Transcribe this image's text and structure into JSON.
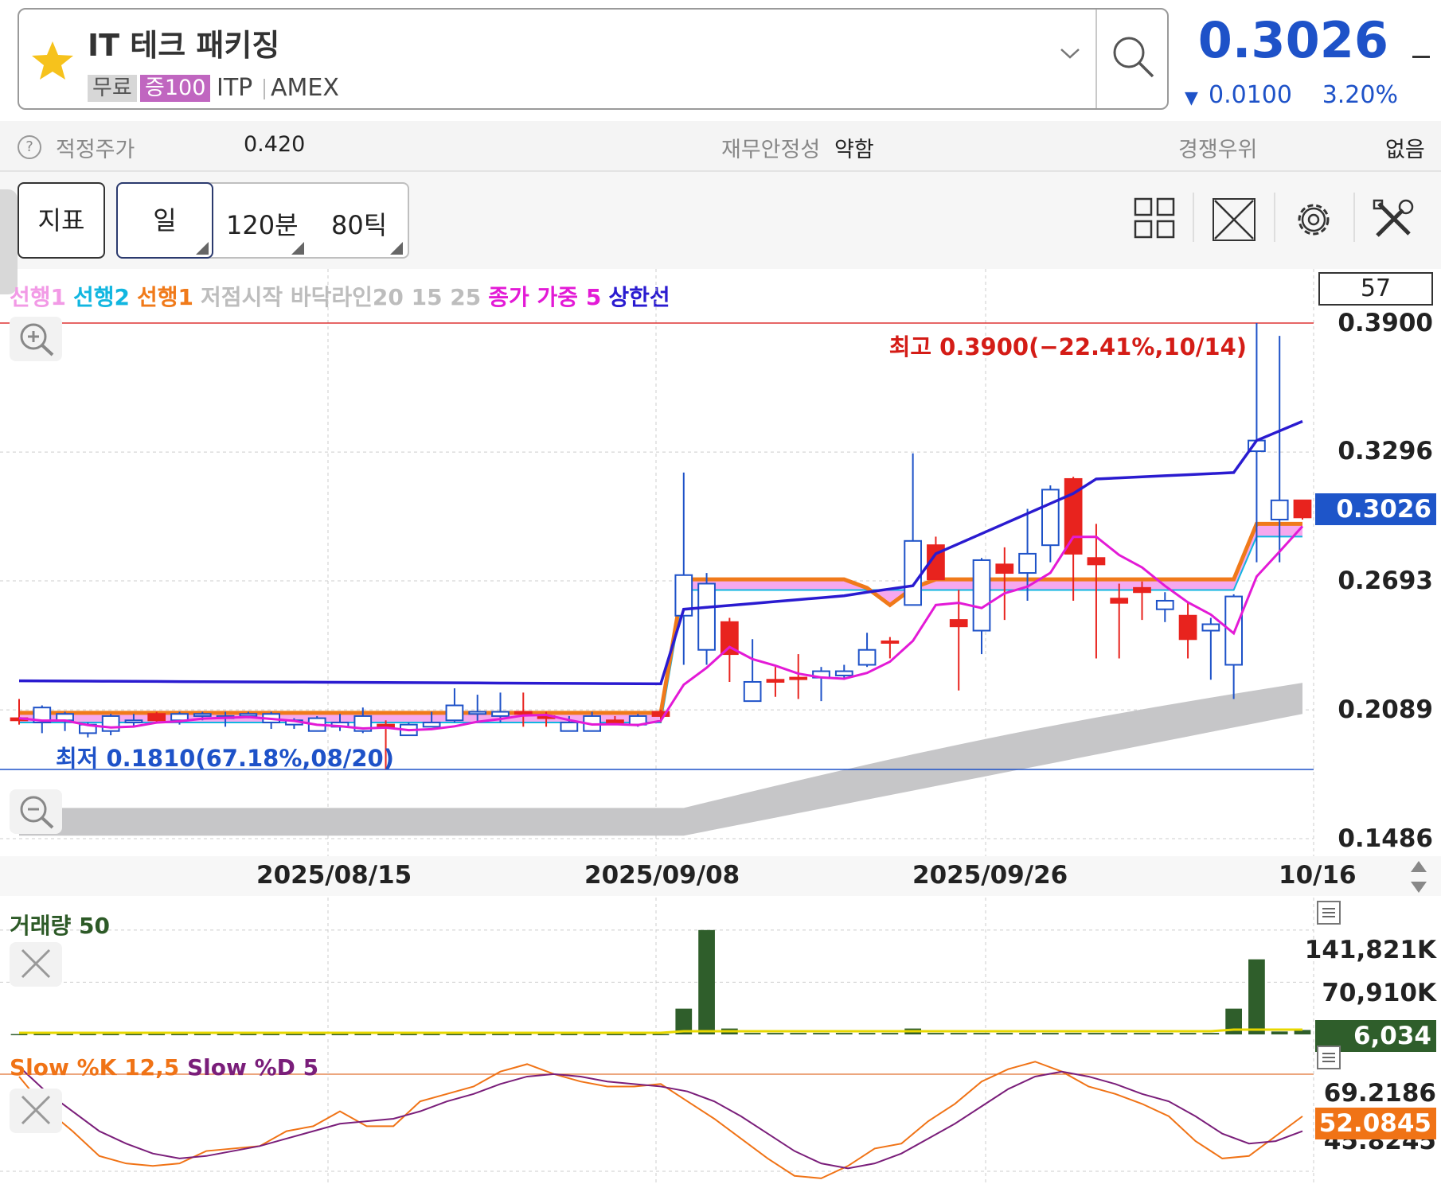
{
  "header": {
    "stock_name": "IT 테크 패키징",
    "badge_free": "무료",
    "badge_margin": "증100",
    "ticker": "ITP",
    "exchange": "AMEX",
    "price": "0.3026",
    "change": "0.0100",
    "change_pct": "3.20%",
    "change_direction": "down",
    "price_color": "#1e52c8"
  },
  "info_bar": {
    "fair_price_label": "적정주가",
    "fair_price_value": "0.420",
    "stability_label": "재무안정성",
    "stability_value": "약함",
    "competitive_label": "경쟁우위",
    "competitive_value": "없음"
  },
  "toolbar": {
    "indicator_label": "지표",
    "period_day": "일",
    "period_120min": "120분",
    "period_80tick": "80틱",
    "icons": [
      "grid-icon",
      "expand-icon",
      "gear-icon",
      "tools-icon"
    ]
  },
  "chart": {
    "legend": [
      {
        "text": "선행1",
        "color": "#f29ae6"
      },
      {
        "text": "선행2",
        "color": "#11b6e0"
      },
      {
        "text": "선행1",
        "color": "#f07a1a"
      },
      {
        "text": "저점시작 바닥라인20 15 25",
        "color": "#bdbdbd"
      },
      {
        "text": "종가 가중 5",
        "color": "#e31ad6"
      },
      {
        "text": "상한선",
        "color": "#2a1bd0"
      }
    ],
    "rsi_value": "57",
    "high_label": "최고 0.3900(−22.41%,10/14)",
    "low_label": "최저 0.1810(67.18%,08/20)",
    "y_labels": [
      "0.3900",
      "0.3296",
      "0.2693",
      "0.2089",
      "0.1486"
    ],
    "current_price_tag": "0.3026",
    "date_labels": [
      "2025/08/15",
      "2025/09/08",
      "2025/09/26",
      "10/16"
    ]
  },
  "chart_data": [
    {
      "type": "candlestick",
      "title": "",
      "ylim": [
        0.1486,
        0.39
      ],
      "grid": true,
      "candles": [
        {
          "o": 0.204,
          "h": 0.214,
          "l": 0.202,
          "c": 0.205
        },
        {
          "o": 0.21,
          "h": 0.211,
          "l": 0.198,
          "c": 0.203
        },
        {
          "o": 0.207,
          "h": 0.208,
          "l": 0.199,
          "c": 0.204
        },
        {
          "o": 0.202,
          "h": 0.203,
          "l": 0.196,
          "c": 0.198
        },
        {
          "o": 0.206,
          "h": 0.207,
          "l": 0.197,
          "c": 0.199
        },
        {
          "o": 0.204,
          "h": 0.207,
          "l": 0.201,
          "c": 0.203
        },
        {
          "o": 0.204,
          "h": 0.208,
          "l": 0.203,
          "c": 0.207
        },
        {
          "o": 0.207,
          "h": 0.208,
          "l": 0.202,
          "c": 0.204
        },
        {
          "o": 0.207,
          "h": 0.208,
          "l": 0.204,
          "c": 0.206
        },
        {
          "o": 0.206,
          "h": 0.208,
          "l": 0.201,
          "c": 0.205
        },
        {
          "o": 0.207,
          "h": 0.208,
          "l": 0.205,
          "c": 0.206
        },
        {
          "o": 0.207,
          "h": 0.208,
          "l": 0.2,
          "c": 0.203
        },
        {
          "o": 0.204,
          "h": 0.205,
          "l": 0.2,
          "c": 0.202
        },
        {
          "o": 0.205,
          "h": 0.206,
          "l": 0.199,
          "c": 0.199
        },
        {
          "o": 0.203,
          "h": 0.207,
          "l": 0.199,
          "c": 0.201
        },
        {
          "o": 0.206,
          "h": 0.21,
          "l": 0.198,
          "c": 0.199
        },
        {
          "o": 0.201,
          "h": 0.204,
          "l": 0.181,
          "c": 0.202
        },
        {
          "o": 0.202,
          "h": 0.203,
          "l": 0.197,
          "c": 0.197
        },
        {
          "o": 0.203,
          "h": 0.208,
          "l": 0.201,
          "c": 0.201
        },
        {
          "o": 0.211,
          "h": 0.219,
          "l": 0.203,
          "c": 0.204
        },
        {
          "o": 0.208,
          "h": 0.216,
          "l": 0.203,
          "c": 0.207
        },
        {
          "o": 0.208,
          "h": 0.217,
          "l": 0.203,
          "c": 0.206
        },
        {
          "o": 0.207,
          "h": 0.217,
          "l": 0.201,
          "c": 0.208
        },
        {
          "o": 0.205,
          "h": 0.208,
          "l": 0.201,
          "c": 0.206
        },
        {
          "o": 0.203,
          "h": 0.206,
          "l": 0.2,
          "c": 0.199
        },
        {
          "o": 0.206,
          "h": 0.208,
          "l": 0.199,
          "c": 0.199
        },
        {
          "o": 0.203,
          "h": 0.206,
          "l": 0.202,
          "c": 0.204
        },
        {
          "o": 0.206,
          "h": 0.207,
          "l": 0.201,
          "c": 0.202
        },
        {
          "o": 0.206,
          "h": 0.209,
          "l": 0.203,
          "c": 0.208
        },
        {
          "o": 0.272,
          "h": 0.32,
          "l": 0.23,
          "c": 0.253
        },
        {
          "o": 0.268,
          "h": 0.273,
          "l": 0.23,
          "c": 0.237
        },
        {
          "o": 0.235,
          "h": 0.252,
          "l": 0.222,
          "c": 0.25
        },
        {
          "o": 0.222,
          "h": 0.242,
          "l": 0.216,
          "c": 0.213
        },
        {
          "o": 0.222,
          "h": 0.229,
          "l": 0.215,
          "c": 0.223
        },
        {
          "o": 0.224,
          "h": 0.235,
          "l": 0.214,
          "c": 0.224
        },
        {
          "o": 0.227,
          "h": 0.229,
          "l": 0.213,
          "c": 0.224
        },
        {
          "o": 0.227,
          "h": 0.23,
          "l": 0.223,
          "c": 0.225
        },
        {
          "o": 0.237,
          "h": 0.245,
          "l": 0.229,
          "c": 0.23
        },
        {
          "o": 0.241,
          "h": 0.243,
          "l": 0.233,
          "c": 0.241
        },
        {
          "o": 0.288,
          "h": 0.329,
          "l": 0.258,
          "c": 0.258
        },
        {
          "o": 0.27,
          "h": 0.29,
          "l": 0.27,
          "c": 0.286
        },
        {
          "o": 0.248,
          "h": 0.265,
          "l": 0.218,
          "c": 0.251
        },
        {
          "o": 0.279,
          "h": 0.28,
          "l": 0.235,
          "c": 0.246
        },
        {
          "o": 0.273,
          "h": 0.285,
          "l": 0.251,
          "c": 0.277
        },
        {
          "o": 0.282,
          "h": 0.303,
          "l": 0.26,
          "c": 0.273
        },
        {
          "o": 0.312,
          "h": 0.314,
          "l": 0.278,
          "c": 0.286
        },
        {
          "o": 0.282,
          "h": 0.318,
          "l": 0.26,
          "c": 0.317
        },
        {
          "o": 0.277,
          "h": 0.296,
          "l": 0.233,
          "c": 0.28
        },
        {
          "o": 0.259,
          "h": 0.268,
          "l": 0.233,
          "c": 0.261
        },
        {
          "o": 0.264,
          "h": 0.269,
          "l": 0.251,
          "c": 0.266
        },
        {
          "o": 0.26,
          "h": 0.264,
          "l": 0.25,
          "c": 0.256
        },
        {
          "o": 0.242,
          "h": 0.259,
          "l": 0.233,
          "c": 0.253
        },
        {
          "o": 0.249,
          "h": 0.252,
          "l": 0.223,
          "c": 0.246
        },
        {
          "o": 0.262,
          "h": 0.263,
          "l": 0.214,
          "c": 0.23
        },
        {
          "o": 0.335,
          "h": 0.39,
          "l": 0.278,
          "c": 0.33
        },
        {
          "o": 0.307,
          "h": 0.384,
          "l": 0.278,
          "c": 0.298
        },
        {
          "o": 0.299,
          "h": 0.307,
          "l": 0.298,
          "c": 0.307
        }
      ]
    },
    {
      "type": "bar",
      "title": "거래량 50",
      "ylim": [
        0,
        160000
      ],
      "tick_labels": [
        "141,821K",
        "70,910K"
      ],
      "current_value_tag": "6,034",
      "note_series": "volume",
      "values": [
        500,
        500,
        500,
        500,
        500,
        500,
        500,
        500,
        500,
        500,
        500,
        500,
        500,
        500,
        500,
        500,
        500,
        500,
        500,
        500,
        500,
        500,
        500,
        500,
        500,
        500,
        500,
        500,
        500,
        35000,
        141821,
        8000,
        2000,
        2000,
        2000,
        2000,
        2000,
        2000,
        2000,
        8000,
        2000,
        2000,
        2000,
        2000,
        2000,
        2000,
        2000,
        2000,
        2000,
        2000,
        2000,
        2000,
        2000,
        35000,
        102000,
        4000,
        6034
      ]
    },
    {
      "type": "line",
      "title": "Slow %K 12,5 Slow %D 5",
      "tick_labels": [
        "69.2186",
        "45.8245"
      ],
      "current_value_tag": "52.0845",
      "series": [
        {
          "name": "Slow %K 12,5",
          "color": "#f07316",
          "values": [
            60,
            47,
            38,
            28,
            25,
            24,
            25,
            30,
            31,
            32,
            38,
            40,
            46,
            40,
            40,
            50,
            53,
            56,
            62,
            65,
            61,
            58,
            56,
            56,
            57,
            50,
            43,
            35,
            27,
            20,
            19,
            24,
            31,
            33,
            42,
            49,
            58,
            63,
            66,
            62,
            56,
            53,
            49,
            44,
            34,
            27,
            28,
            36,
            44
          ]
        },
        {
          "name": "Slow %D 5",
          "color": "#7a1e7a",
          "values": [
            64,
            54,
            46,
            38,
            33,
            29,
            27,
            28,
            30,
            32,
            35,
            38,
            41,
            42,
            43,
            46,
            50,
            53,
            57,
            60,
            61,
            60,
            58,
            57,
            56,
            54,
            50,
            44,
            37,
            30,
            25,
            23,
            25,
            29,
            35,
            41,
            48,
            55,
            60,
            62,
            60,
            57,
            53,
            50,
            44,
            37,
            33,
            34,
            38
          ]
        }
      ]
    }
  ]
}
